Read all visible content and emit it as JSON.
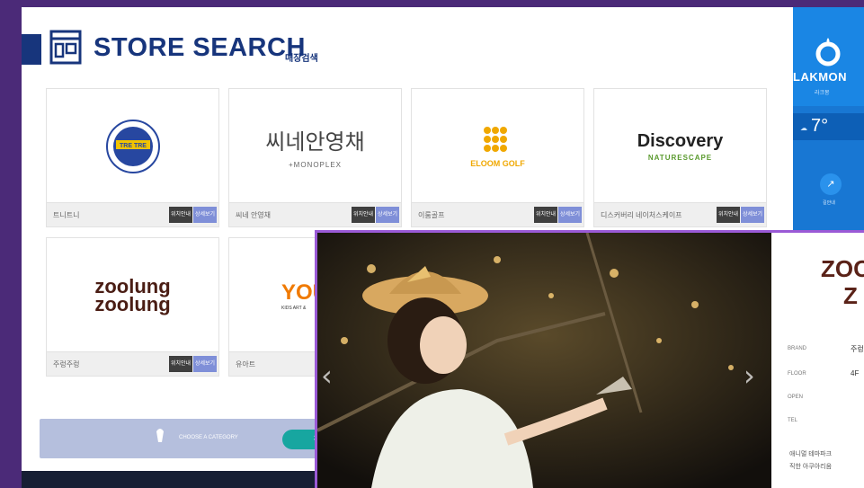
{
  "header": {
    "title": "STORE SEARCH",
    "subtitle": "매장검색"
  },
  "stores": [
    {
      "name": "트니트니",
      "logo_text": "TRE TRE",
      "btn_map": "위치안내",
      "btn_detail": "상세보기"
    },
    {
      "name": "씨네 안영채",
      "logo_text": "씨네안영채",
      "logo_sub": "+MONOPLEX",
      "btn_map": "위치안내",
      "btn_detail": "상세보기"
    },
    {
      "name": "이룸골프",
      "logo_text": "ELOOM GOLF",
      "btn_map": "위치안내",
      "btn_detail": "상세보기"
    },
    {
      "name": "디스커버리 네이처스케이프",
      "logo_text": "Discovery",
      "logo_sub": "NATURESCAPE",
      "btn_map": "위치안내",
      "btn_detail": "상세보기"
    },
    {
      "name": "주렁주렁",
      "logo_text": "zoolung",
      "logo_text2": "zoolung",
      "btn_map": "위치안내",
      "btn_detail": "상세보기"
    },
    {
      "name": "유아트",
      "logo_text": "YOU",
      "logo_sub": "KIDS ART &",
      "btn_map": "위치안내",
      "btn_detail": "상세보기"
    }
  ],
  "category_bar": {
    "label": "CHOOSE A CATEGORY",
    "button": "전체"
  },
  "right_panel": {
    "brand": "LAKMON",
    "brand_sub": "라크몽",
    "temperature": "7°",
    "weather_icon": "cloud-icon",
    "guide_label": "길안내"
  },
  "popup": {
    "logo_line1": "ZOO",
    "logo_line2": "Z",
    "labels": {
      "brand": "BRAND",
      "floor": "FLOOR",
      "open": "OPEN",
      "tel": "TEL"
    },
    "values": {
      "brand": "주렁",
      "floor": "4F"
    },
    "desc_lines": [
      "애니멀 테마파크",
      "직한 아쿠아리움"
    ],
    "prev_arrow": "‹",
    "next_arrow": "›"
  },
  "colors": {
    "background": "#4b2a78",
    "title": "#17357c",
    "popup_border": "#9a5ad6",
    "panel_blue": "#1877d3",
    "teal": "#17a6a0"
  }
}
